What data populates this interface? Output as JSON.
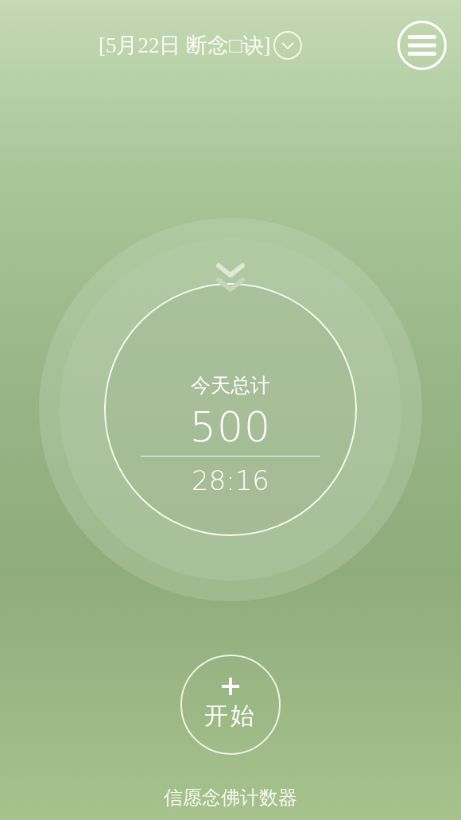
{
  "header": {
    "title": "[5月22日 断念□诀]"
  },
  "counter": {
    "label": "今天总计",
    "count": "500",
    "time": "28:16"
  },
  "start_button": {
    "label": "开始"
  },
  "footer": {
    "app_name": "信愿念佛计数器"
  }
}
